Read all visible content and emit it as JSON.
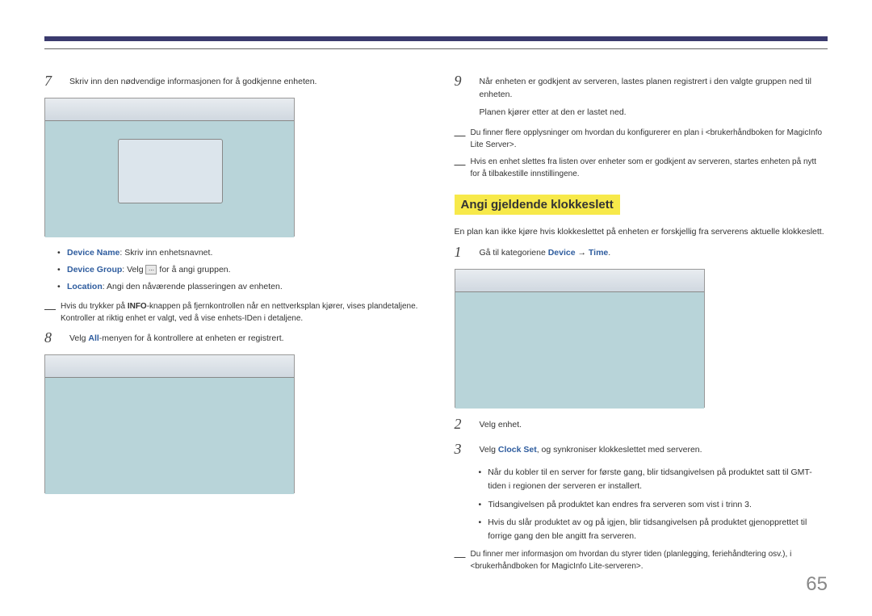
{
  "page_number": "65",
  "left": {
    "step7": {
      "num": "7",
      "text": "Skriv inn den nødvendige informasjonen for å godkjenne enheten."
    },
    "bullets": {
      "device_name_label": "Device Name",
      "device_name_text": ": Skriv inn enhetsnavnet.",
      "device_group_label": "Device Group",
      "device_group_text1": ": Velg ",
      "device_group_text2": " for å angi gruppen.",
      "location_label": "Location",
      "location_text": ": Angi den nåværende plasseringen av enheten."
    },
    "note1a": "Hvis du trykker på ",
    "note1b": "INFO",
    "note1c": "-knappen på fjernkontrollen når en nettverksplan kjører, vises plandetaljene. Kontroller at riktig enhet er valgt, ved å vise enhets-IDen i detaljene.",
    "step8": {
      "num": "8",
      "text1": "Velg ",
      "text2": "All",
      "text3": "-menyen for å kontrollere at enheten er registrert."
    }
  },
  "right": {
    "step9": {
      "num": "9",
      "line1": "Når enheten er godkjent av serveren, lastes planen registrert i den valgte gruppen ned til enheten.",
      "line2": "Planen kjører etter at den er lastet ned."
    },
    "note1": "Du finner flere opplysninger om hvordan du konfigurerer en plan i <brukerhåndboken for MagicInfo Lite Server>.",
    "note2": "Hvis en enhet slettes fra listen over enheter som er godkjent av serveren, startes enheten på nytt for å tilbakestille innstillingene.",
    "section_title": "Angi gjeldende klokkeslett",
    "intro": "En plan kan ikke kjøre hvis klokkeslettet på enheten er forskjellig fra serverens aktuelle klokkeslett.",
    "step1": {
      "num": "1",
      "text1": "Gå til kategoriene ",
      "text2": "Device",
      "text3": " → ",
      "text4": "Time",
      "text5": "."
    },
    "step2": {
      "num": "2",
      "text": "Velg enhet."
    },
    "step3": {
      "num": "3",
      "text1": "Velg ",
      "text2": "Clock Set",
      "text3": ", og synkroniser klokkeslettet med serveren."
    },
    "sub_bullets": {
      "b1": "Når du kobler til en server for første gang, blir tidsangivelsen på produktet satt til GMT-tiden i regionen der serveren er installert.",
      "b2": "Tidsangivelsen på produktet kan endres fra serveren som vist i trinn 3.",
      "b3": "Hvis du slår produktet av og på igjen, blir tidsangivelsen på produktet gjenopprettet til forrige gang den ble angitt fra serveren."
    },
    "note3": "Du finner mer informasjon om hvordan du styrer tiden (planlegging, feriehåndtering osv.), i <brukerhåndboken for MagicInfo Lite-serveren>."
  }
}
